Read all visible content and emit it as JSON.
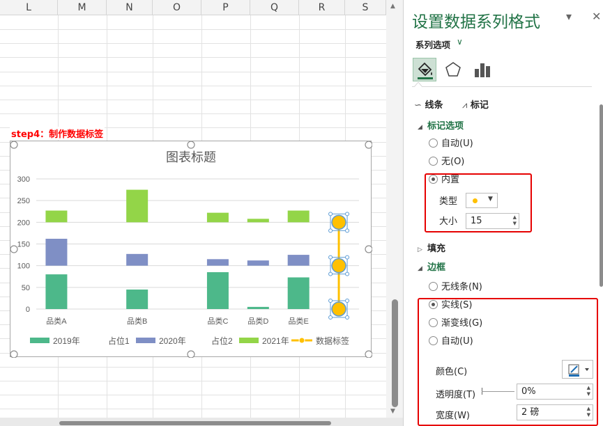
{
  "sheet": {
    "columns": [
      "L",
      "M",
      "N",
      "O",
      "P",
      "Q",
      "R",
      "S"
    ],
    "step_note": "step4：制作数据标签"
  },
  "chart_data": {
    "type": "bar",
    "title": "图表标题",
    "categories": [
      "品类A",
      "占位1",
      "品类B",
      "占位2",
      "品类C",
      "品类D",
      "品类E",
      ""
    ],
    "xlabels": [
      "品类A",
      "品类B",
      "品类C",
      "品类D",
      "品类E"
    ],
    "ylim": [
      0,
      300
    ],
    "yticks": [
      0,
      50,
      100,
      150,
      200,
      250,
      300
    ],
    "series": [
      {
        "name": "2019年",
        "color": "#4db88a",
        "base": 0,
        "values": [
          80,
          45,
          85,
          5,
          73
        ]
      },
      {
        "name": "2020年",
        "color": "#7f8fc5",
        "base": 100,
        "values": [
          62,
          27,
          15,
          12,
          25
        ]
      },
      {
        "name": "2021年",
        "color": "#93d548",
        "base": 200,
        "values": [
          27,
          75,
          22,
          8,
          27
        ]
      }
    ],
    "legend": [
      "2019年",
      "占位1",
      "2020年",
      "占位2",
      "2021年",
      "数据标签"
    ],
    "legend_position": "bottom",
    "grid": true,
    "label_series": {
      "name": "数据标签",
      "color": "#ffc000",
      "values": [
        0,
        100,
        200
      ]
    }
  },
  "pane": {
    "title": "设置数据系列格式",
    "series_options": "系列选项",
    "tabs": [
      "fill-line-icon",
      "effects-icon",
      "series-options-icon"
    ],
    "subtabs": {
      "line": "线条",
      "marker": "标记"
    },
    "marker_options": {
      "title": "标记选项",
      "auto": "自动(U)",
      "none": "无(O)",
      "builtin": "内置",
      "type_label": "类型",
      "size_label": "大小",
      "size_value": "15"
    },
    "fill": "填充",
    "border": {
      "title": "边框",
      "no_line": "无线条(N)",
      "solid": "实线(S)",
      "gradient": "渐变线(G)",
      "auto": "自动(U)",
      "color_label": "颜色(C)",
      "transparency_label": "透明度(T)",
      "transparency_value": "0%",
      "width_label": "宽度(W)",
      "width_value": "2 磅"
    }
  }
}
